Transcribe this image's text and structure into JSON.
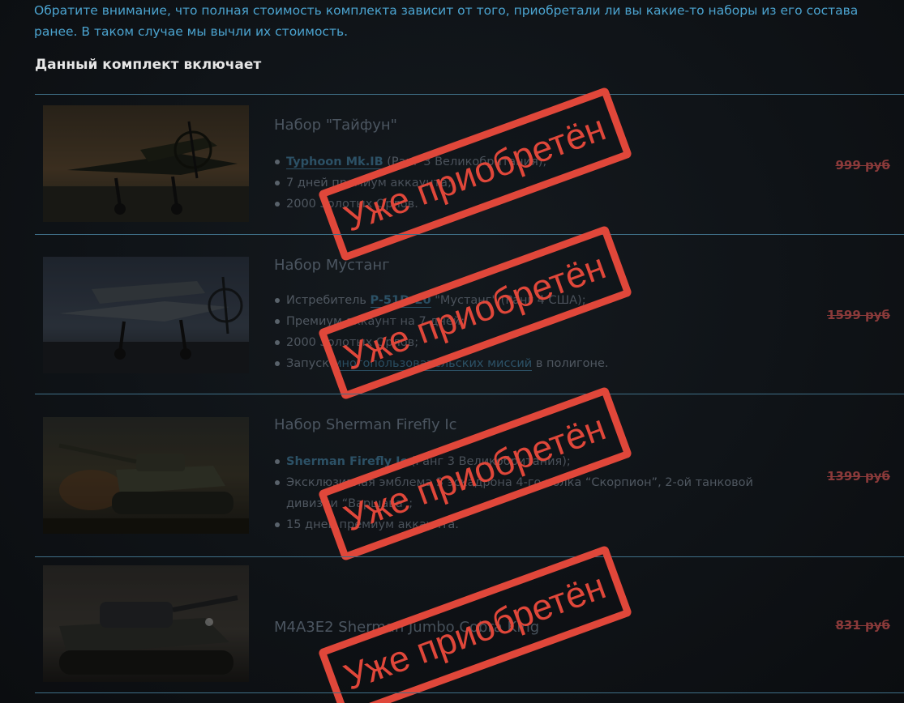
{
  "notice": {
    "text": "Обратите внимание, что полная стоимость комплекта зависит от того, приобретали ли вы какие-то наборы из его состава ранее. В таком случае мы вычли их стоимость."
  },
  "section_title": "Данный комплект включает",
  "stamp_text": "Уже приобретён",
  "items": [
    {
      "title": "Набор \"Тайфун\"",
      "bullets": [
        {
          "link": "Typhoon Mk.IB",
          "rest": " (Ранг 3 Великобритания);"
        },
        {
          "text": "7 дней премиум аккаунта;"
        },
        {
          "text": "2000 Золотых Орлов."
        }
      ],
      "price": "999 руб"
    },
    {
      "title": "Набор Мустанг",
      "bullets": [
        {
          "before": "Истребитель ",
          "link": "P-51D-20",
          "rest": " \"Мустанг\" (Ранг 4 США);"
        },
        {
          "text": "Премиум-аккаунт на 7 дней;"
        },
        {
          "text": "2000 Золотых Орлов;"
        },
        {
          "before": "Запуск ",
          "link": "многопользовательских миссий",
          "rest": " в полигоне."
        }
      ],
      "price": "1599 руб"
    },
    {
      "title": "Набор Sherman Firefly Ic",
      "bullets": [
        {
          "link": "Sherman Firefly Ic",
          "rest": " (Ранг 3 Великобритания);"
        },
        {
          "text": "Эксклюзивная эмблема 3 эскадрона 4-го полка “Скорпион”, 2-ой танковой дивизии “Варшава”;"
        },
        {
          "text": "15 дней премиум аккаунта."
        }
      ],
      "price": "1399 руб"
    },
    {
      "title": "M4A3E2 Sherman Jumbo Cobra King",
      "bullets": [],
      "price": "831 руб"
    }
  ],
  "colors": {
    "accent_blue": "#4ba3cf",
    "stamp_red": "#e0473a",
    "price_struck": "#8b3a3a",
    "divider": "#3f6f87"
  }
}
